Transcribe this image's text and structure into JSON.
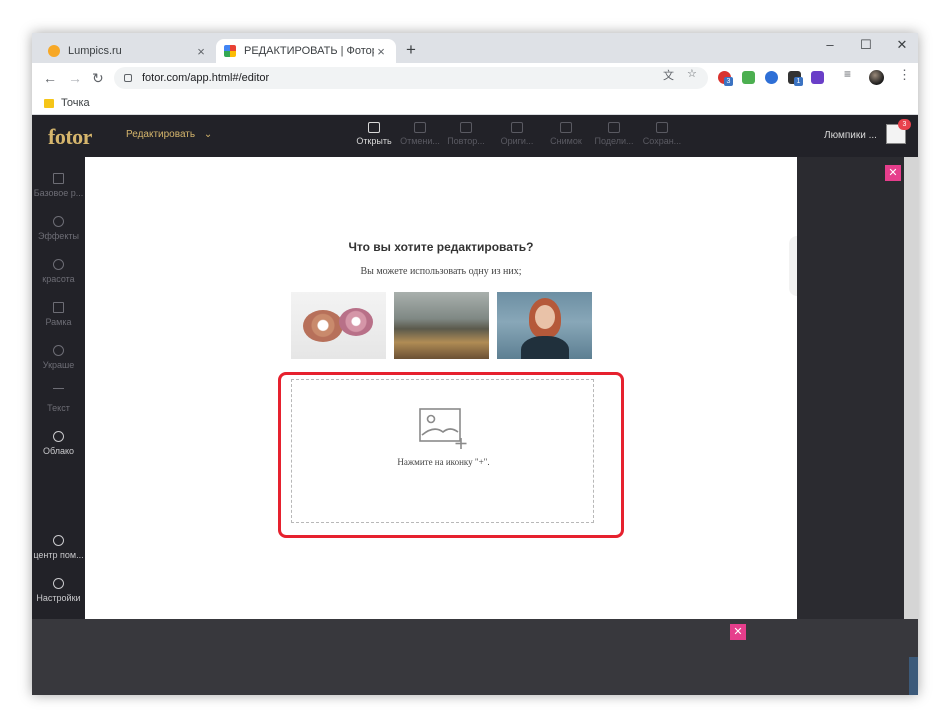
{
  "browser": {
    "tabs": [
      {
        "label": "Lumpics.ru"
      },
      {
        "label": "РЕДАКТИРОВАТЬ | Фотор"
      }
    ],
    "address": "fotor.com/app.html#/editor",
    "bookmark": "Точка",
    "extension_badges": [
      "3",
      "1"
    ]
  },
  "app": {
    "logo": "fotor",
    "mode": "Редактировать",
    "toolbar": [
      {
        "label": "Открыть",
        "icon": "open-image-icon"
      },
      {
        "label": "Отмени...",
        "icon": "undo-icon"
      },
      {
        "label": "Повтор...",
        "icon": "redo-icon"
      },
      {
        "label": "Ориги...",
        "icon": "original-icon"
      },
      {
        "label": "Снимок",
        "icon": "snapshot-icon"
      },
      {
        "label": "Подели...",
        "icon": "share-icon"
      },
      {
        "label": "Сохран...",
        "icon": "save-icon"
      }
    ],
    "user_name": "Люмпики ...",
    "notification_count": "3"
  },
  "sidebar": [
    {
      "label": "Базовое р...",
      "icon": "adjust-icon"
    },
    {
      "label": "Эффекты",
      "icon": "flask-icon"
    },
    {
      "label": "красота",
      "icon": "eye-icon"
    },
    {
      "label": "Рамка",
      "icon": "frame-icon"
    },
    {
      "label": "Украше",
      "icon": "sticker-icon"
    },
    {
      "label": "Текст",
      "icon": "text-icon"
    },
    {
      "label": "Облако",
      "icon": "cloud-upload-icon"
    },
    {
      "label": "центр пом...",
      "icon": "help-icon"
    },
    {
      "label": "Настройки",
      "icon": "settings-icon"
    }
  ],
  "modal": {
    "title": "Что вы хотите редактировать?",
    "subtitle": "Вы можете использовать одну из них;",
    "samples": [
      "donuts",
      "hills",
      "portrait"
    ],
    "drop_hint": "Нажмите на иконку \"+\"."
  },
  "colors": {
    "accent_gold": "#d5b56c",
    "highlight_red": "#e6212e",
    "close_pink": "#e63e8c"
  }
}
